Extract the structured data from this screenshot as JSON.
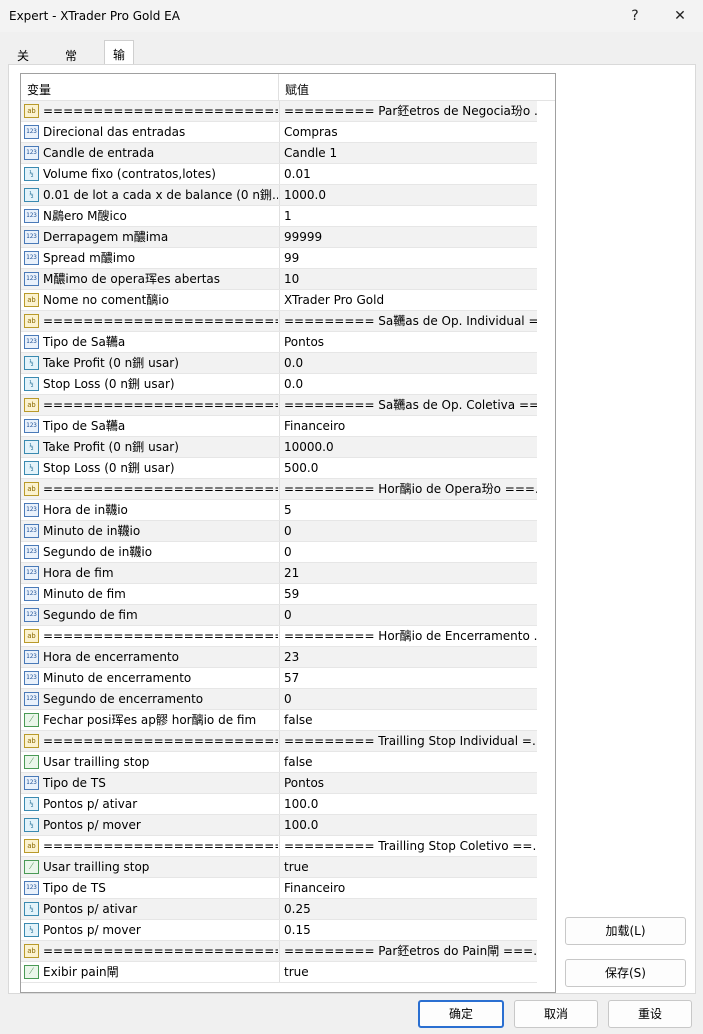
{
  "window": {
    "title": "Expert - XTrader Pro Gold EA",
    "help_glyph": "?",
    "close_glyph": "✕"
  },
  "tabs": [
    {
      "label": "关于"
    },
    {
      "label": "常用"
    },
    {
      "label": "输入参数"
    }
  ],
  "grid": {
    "col_variable": "变量",
    "col_value": "赋值",
    "rows": [
      {
        "type": "ab",
        "icon": "ab",
        "name": "=========================...",
        "value": "========= Par鉟etros de Negocia玢o ..."
      },
      {
        "type": "int",
        "icon": "123",
        "name": "Direcional das entradas",
        "value": "Compras"
      },
      {
        "type": "int",
        "icon": "123",
        "name": "Candle de entrada",
        "value": "Candle 1"
      },
      {
        "type": "dbl",
        "icon": "½",
        "name": "Volume fixo (contratos,lotes)",
        "value": "0.01"
      },
      {
        "type": "dbl",
        "icon": "½",
        "name": "0.01 de lot a cada x de balance (0 n鉶...",
        "value": "1000.0"
      },
      {
        "type": "int",
        "icon": "123",
        "name": "N鷐ero M醙ico",
        "value": "1"
      },
      {
        "type": "int",
        "icon": "123",
        "name": "Derrapagem m醲ima",
        "value": "99999"
      },
      {
        "type": "int",
        "icon": "123",
        "name": "Spread m醲imo",
        "value": "99"
      },
      {
        "type": "int",
        "icon": "123",
        "name": "M醲imo de opera珲es abertas",
        "value": "10"
      },
      {
        "type": "ab",
        "icon": "ab",
        "name": "Nome no coment醨io",
        "value": "XTrader Pro Gold"
      },
      {
        "type": "ab",
        "icon": "ab",
        "name": "=========================...",
        "value": "========= Sa韉as de Op. Individual =..."
      },
      {
        "type": "int",
        "icon": "123",
        "name": "Tipo de Sa韉a",
        "value": "Pontos"
      },
      {
        "type": "dbl",
        "icon": "½",
        "name": "Take Profit (0 n鉶 usar)",
        "value": "0.0"
      },
      {
        "type": "dbl",
        "icon": "½",
        "name": "Stop Loss (0 n鉶 usar)",
        "value": "0.0"
      },
      {
        "type": "ab",
        "icon": "ab",
        "name": "=========================...",
        "value": "========= Sa韉as de Op. Coletiva ==..."
      },
      {
        "type": "int",
        "icon": "123",
        "name": "Tipo de Sa韉a",
        "value": "Financeiro"
      },
      {
        "type": "dbl",
        "icon": "½",
        "name": "Take Profit (0 n鉶 usar)",
        "value": "10000.0"
      },
      {
        "type": "dbl",
        "icon": "½",
        "name": "Stop Loss (0 n鉶 usar)",
        "value": "500.0"
      },
      {
        "type": "ab",
        "icon": "ab",
        "name": "=========================...",
        "value": "========= Hor醨io de Opera玢o ===..."
      },
      {
        "type": "int",
        "icon": "123",
        "name": "Hora de in韈io",
        "value": "5"
      },
      {
        "type": "int",
        "icon": "123",
        "name": "Minuto de in韈io",
        "value": "0"
      },
      {
        "type": "int",
        "icon": "123",
        "name": "Segundo de in韈io",
        "value": "0"
      },
      {
        "type": "int",
        "icon": "123",
        "name": "Hora de fim",
        "value": "21"
      },
      {
        "type": "int",
        "icon": "123",
        "name": "Minuto de fim",
        "value": "59"
      },
      {
        "type": "int",
        "icon": "123",
        "name": "Segundo de fim",
        "value": "0"
      },
      {
        "type": "ab",
        "icon": "ab",
        "name": "=========================...",
        "value": "========= Hor醨io de Encerramento ..."
      },
      {
        "type": "int",
        "icon": "123",
        "name": "Hora de encerramento",
        "value": "23"
      },
      {
        "type": "int",
        "icon": "123",
        "name": "Minuto de encerramento",
        "value": "57"
      },
      {
        "type": "int",
        "icon": "123",
        "name": "Segundo de encerramento",
        "value": "0"
      },
      {
        "type": "bool",
        "icon": "⁄",
        "name": "Fechar posi珲es ap髎 hor醨io de fim",
        "value": "false"
      },
      {
        "type": "ab",
        "icon": "ab",
        "name": "=========================...",
        "value": "========= Trailling Stop Individual =..."
      },
      {
        "type": "bool",
        "icon": "⁄",
        "name": "Usar trailling stop",
        "value": "false"
      },
      {
        "type": "int",
        "icon": "123",
        "name": "Tipo de TS",
        "value": "Pontos"
      },
      {
        "type": "dbl",
        "icon": "½",
        "name": "Pontos p/ ativar",
        "value": "100.0"
      },
      {
        "type": "dbl",
        "icon": "½",
        "name": "Pontos p/ mover",
        "value": "100.0"
      },
      {
        "type": "ab",
        "icon": "ab",
        "name": "=========================...",
        "value": "========= Trailling Stop Coletivo ==..."
      },
      {
        "type": "bool",
        "icon": "⁄",
        "name": "Usar trailling stop",
        "value": "true"
      },
      {
        "type": "int",
        "icon": "123",
        "name": "Tipo de TS",
        "value": "Financeiro"
      },
      {
        "type": "dbl",
        "icon": "½",
        "name": "Pontos p/ ativar",
        "value": "0.25"
      },
      {
        "type": "dbl",
        "icon": "½",
        "name": "Pontos p/ mover",
        "value": "0.15"
      },
      {
        "type": "ab",
        "icon": "ab",
        "name": "=========================...",
        "value": "========= Par鉟etros do Pain閘 ===..."
      },
      {
        "type": "bool",
        "icon": "⁄",
        "name": "Exibir pain閘",
        "value": "true"
      }
    ]
  },
  "side_buttons": {
    "load": "加载(L)",
    "save": "保存(S)"
  },
  "bottom_buttons": {
    "ok": "确定",
    "cancel": "取消",
    "reset": "重设"
  },
  "colors": {
    "accent": "#2a6fd1",
    "row_alt": "#f2f2f2"
  }
}
